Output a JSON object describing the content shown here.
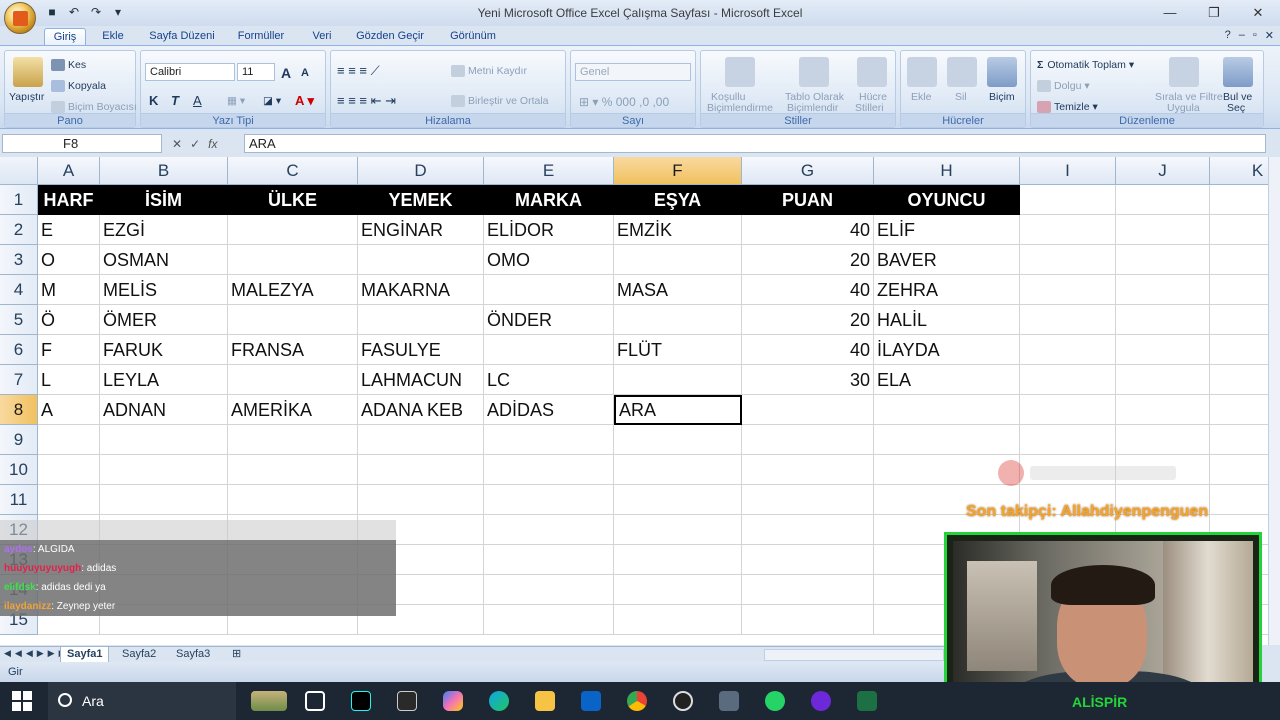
{
  "window": {
    "title": "Yeni Microsoft Office Excel Çalışma Sayfası - Microsoft Excel",
    "minimize": "—",
    "restore": "❐",
    "close": "✕"
  },
  "qat": [
    "save-icon",
    "undo-icon",
    "redo-icon",
    "customize-icon"
  ],
  "tabs": [
    "Giriş",
    "Ekle",
    "Sayfa Düzeni",
    "Formüller",
    "Veri",
    "Gözden Geçir",
    "Görünüm"
  ],
  "ribbon": {
    "pano": {
      "label": "Pano",
      "paste": "Yapıştır",
      "cut": "Kes",
      "copy": "Kopyala",
      "format_painter": "Biçim Boyacısı"
    },
    "font": {
      "label": "Yazı Tipi",
      "name": "Calibri",
      "size": "11",
      "bold": "K",
      "italic": "T",
      "underline": "A"
    },
    "alignment": {
      "label": "Hizalama",
      "wrap": "Metni Kaydır",
      "merge": "Birleştir ve Ortala"
    },
    "number": {
      "label": "Sayı",
      "format": "Genel"
    },
    "styles": {
      "label": "Stiller",
      "conditional_l1": "Koşullu",
      "conditional_l2": "Biçimlendirme",
      "table_l1": "Tablo Olarak",
      "table_l2": "Biçimlendir",
      "cell_l1": "Hücre",
      "cell_l2": "Stilleri"
    },
    "cells": {
      "label": "Hücreler",
      "insert": "Ekle",
      "delete": "Sil",
      "format": "Biçim"
    },
    "editing": {
      "label": "Düzenleme",
      "autosum": "Otomatik Toplam",
      "fill": "Dolgu",
      "clear": "Temizle",
      "sort_l1": "Sırala ve Filtre",
      "sort_l2": "Uygula",
      "find_l1": "Bul ve",
      "find_l2": "Seç"
    }
  },
  "formula_bar": {
    "name_box": "F8",
    "fx": "fx",
    "content": "ARA"
  },
  "columns": [
    "A",
    "B",
    "C",
    "D",
    "E",
    "F",
    "G",
    "H",
    "I",
    "J",
    "K"
  ],
  "rows": [
    "1",
    "2",
    "3",
    "4",
    "5",
    "6",
    "7",
    "8",
    "9",
    "10",
    "11",
    "12",
    "13",
    "14",
    "15"
  ],
  "table": {
    "headers": [
      "HARF",
      "İSİM",
      "ÜLKE",
      "YEMEK",
      "MARKA",
      "EŞYA",
      "PUAN",
      "OYUNCU"
    ],
    "rows": [
      [
        "E",
        "EZGİ",
        "",
        "ENGİNAR",
        "ELİDOR",
        "EMZİK",
        "40",
        "ELİF"
      ],
      [
        "O",
        "OSMAN",
        "",
        "",
        "OMO",
        "",
        "20",
        "BAVER"
      ],
      [
        "M",
        "MELİS",
        "MALEZYA",
        "MAKARNA",
        "",
        "MASA",
        "40",
        "ZEHRA"
      ],
      [
        "Ö",
        "ÖMER",
        "",
        "",
        "ÖNDER",
        "",
        "20",
        "HALİL"
      ],
      [
        "F",
        "FARUK",
        "FRANSA",
        "FASULYE",
        "",
        "FLÜT",
        "40",
        "İLAYDA"
      ],
      [
        "L",
        "LEYLA",
        "",
        "LAHMACUN",
        "LC",
        "",
        "30",
        "ELA"
      ],
      [
        "A",
        "ADNAN",
        "AMERİKA",
        "ADANA KEB",
        "ADİDAS",
        "ARA",
        "",
        ""
      ]
    ]
  },
  "chat": [
    {
      "user": "aydos",
      "msg": ": ALGIDA"
    },
    {
      "user": "huuyuyuyuyugh",
      "msg": ": adidas"
    },
    {
      "user": "elifdsk",
      "msg": ": adidas dedi ya"
    },
    {
      "user": "ilaydanizz",
      "msg": ": Zeynep yeter"
    }
  ],
  "overlay": {
    "follower": "Son takipçi: Allahdiyenpenguen",
    "streamer": "ALİSPİR"
  },
  "sheets": [
    "Sayfa1",
    "Sayfa2",
    "Sayfa3"
  ],
  "status": "Gir",
  "taskbar": {
    "search": "Ara"
  },
  "colors": {
    "header_bg": "#000000",
    "header_fg": "#ffffff",
    "selected_header": "#f1c15f",
    "webcam_border": "#22d43a",
    "follower_text": "#f4a42b"
  }
}
